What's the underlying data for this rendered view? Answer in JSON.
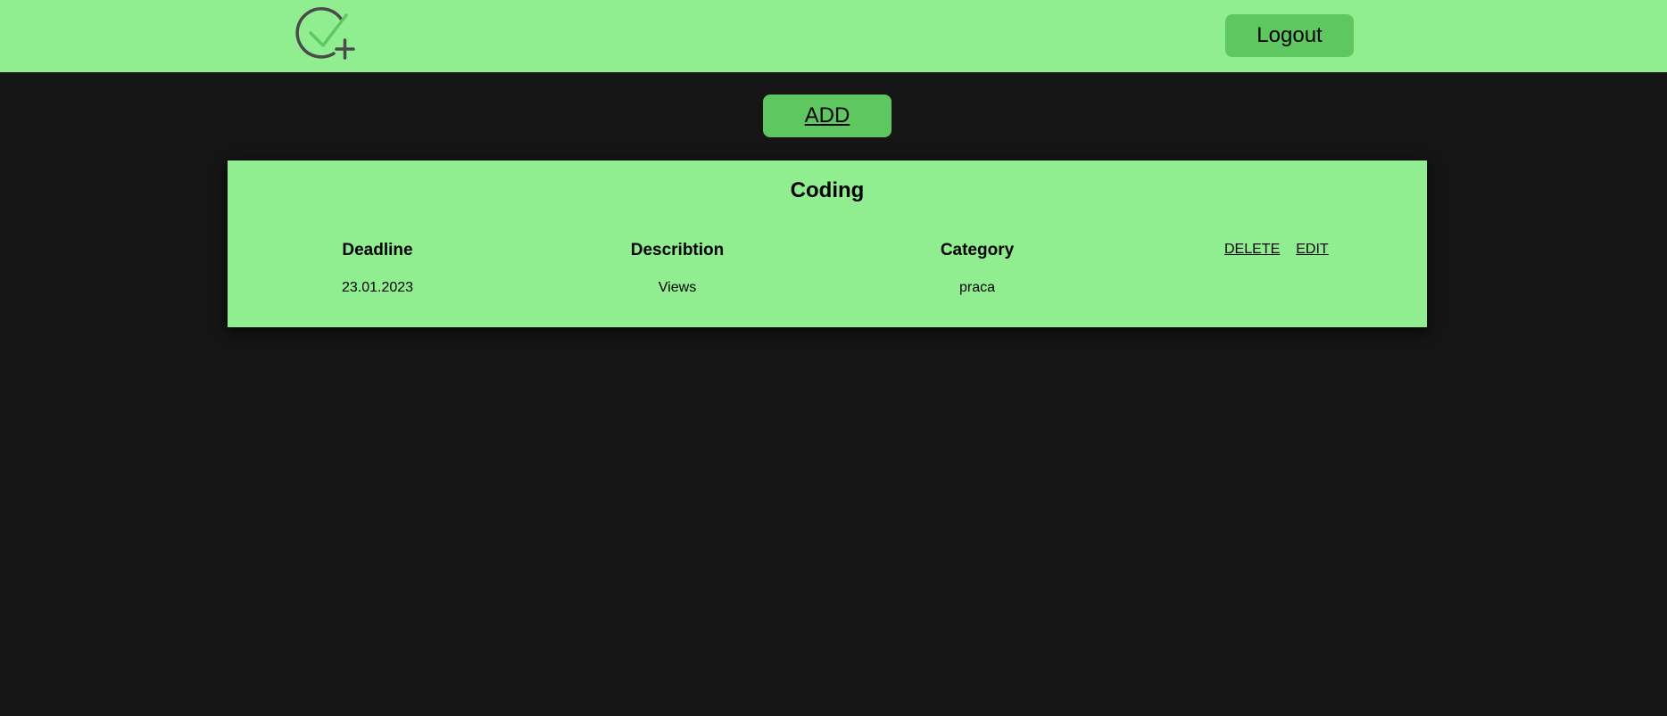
{
  "header": {
    "logo_icon": "check-circle-plus-icon",
    "logout_label": "Logout"
  },
  "toolbar": {
    "add_label": "ADD"
  },
  "colors": {
    "header_bg": "#90ee90",
    "button_bg": "#5fc75f",
    "page_bg": "#151515",
    "logo_circle": "#4a4a4a",
    "logo_check": "#5fc75f"
  },
  "tasks": [
    {
      "title": "Coding",
      "columns": {
        "deadline_header": "Deadline",
        "description_header": "Describtion",
        "category_header": "Category"
      },
      "deadline": "23.01.2023",
      "description": "Views",
      "category": "praca",
      "delete_label": "DELETE",
      "edit_label": "EDIT"
    }
  ]
}
